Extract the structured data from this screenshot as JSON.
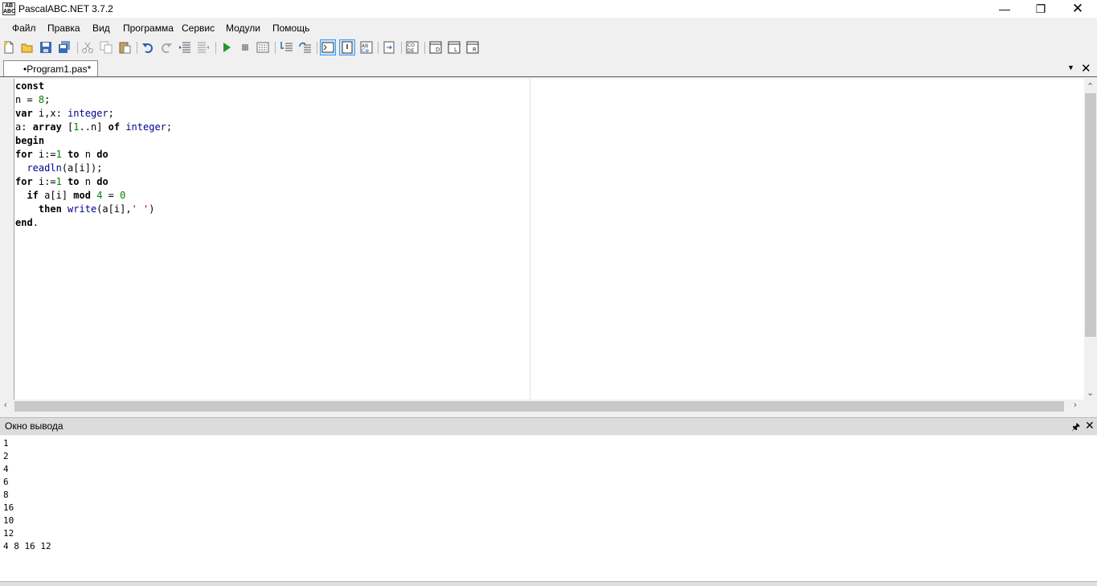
{
  "window": {
    "title": "PascalABC.NET 3.7.2",
    "icon_text": "AB ABC"
  },
  "menu": [
    "Файл",
    "Правка",
    "Вид",
    "Программа",
    "Сервис",
    "Модули",
    "Помощь"
  ],
  "toolbar_icons": [
    "new-file-icon",
    "open-icon",
    "save-icon",
    "save-all-icon",
    "cut-icon",
    "copy-icon",
    "paste-icon",
    "undo-icon",
    "redo-icon",
    "indent-icon",
    "unindent-icon",
    "run-icon",
    "stop-icon",
    "compile-icon",
    "step-into-icon",
    "step-over-icon",
    "console-toggle-icon",
    "output-toggle-icon",
    "watch-icon",
    "navigate-icon",
    "code-icon",
    "form-designer-icon",
    "toolbox-icon",
    "properties-icon"
  ],
  "tabs": [
    {
      "label": "•Program1.pas*",
      "active": true
    }
  ],
  "editor": {
    "lines": [
      "const",
      "n = 8;",
      "var i,x: integer;",
      "a: array [1..n] of integer;",
      "begin",
      "for i:=1 to n do",
      "  readln(a[i]);",
      "for i:=1 to n do",
      "  if a[i] mod 4 = 0",
      "    then write(a[i],' ')",
      "end."
    ]
  },
  "output_panel": {
    "title": "Окно вывода",
    "lines": [
      "1",
      "2",
      "4",
      "6",
      "8",
      "16",
      "10",
      "12",
      "4 8 16 12"
    ]
  },
  "colors": {
    "keyword": "#000000",
    "type": "#00008b",
    "number": "#008000",
    "string": "#b00000",
    "selection": "#cce4f7"
  }
}
